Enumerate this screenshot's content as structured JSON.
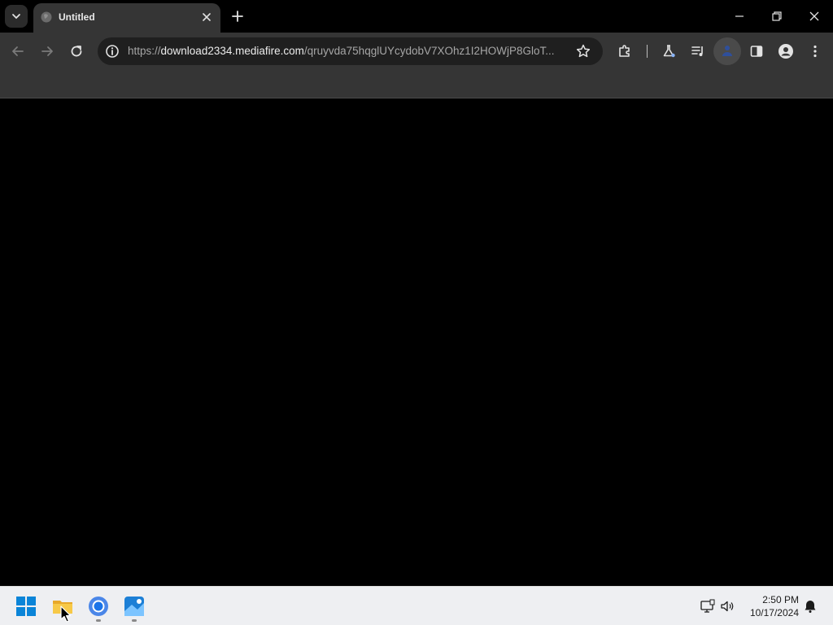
{
  "browser": {
    "tab": {
      "title": "Untitled"
    },
    "address_bar": {
      "scheme": "https://",
      "host": "download2334.mediafire.com",
      "path": "/qruyvda75hqglUYcydobV7XOhz1I2HOWjP8GloT..."
    },
    "toolbar_icons": [
      "back-icon",
      "forward-icon",
      "reload-icon",
      "site-info-icon",
      "bookmark-star-icon",
      "extensions-icon",
      "labs-icon",
      "media-controls-icon",
      "profile-extension-icon",
      "side-panel-icon",
      "profile-avatar-icon",
      "menu-icon"
    ],
    "window_controls": [
      "minimize-icon",
      "restore-icon",
      "close-icon"
    ]
  },
  "taskbar": {
    "apps": [
      {
        "name": "start-button",
        "icon": "windows-logo-icon"
      },
      {
        "name": "file-explorer",
        "icon": "folder-icon",
        "running": false
      },
      {
        "name": "chrome",
        "icon": "chrome-icon",
        "running": true
      },
      {
        "name": "photos",
        "icon": "photos-icon",
        "running": true
      }
    ],
    "clock": {
      "time": "2:50 PM",
      "date": "10/17/2024"
    }
  },
  "colors": {
    "toolbar_bg": "#353535",
    "omnibox_bg": "#1f1f1f",
    "page_bg": "#000000",
    "taskbar_bg": "#eeeff2",
    "windows_blue": "#0a84d8"
  }
}
